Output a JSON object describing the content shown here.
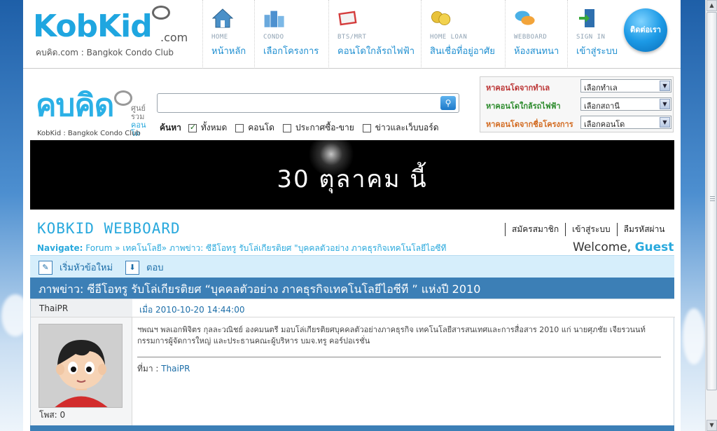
{
  "site": {
    "logo_text": "KobKid",
    "logo_tld": ".com",
    "logo_sub": "คบคิด.com : Bangkok Condo Club"
  },
  "nav": [
    {
      "en": "HOME",
      "th": "หน้าหลัก",
      "icon": "home-icon"
    },
    {
      "en": "CONDO",
      "th": "เลือกโครงการ",
      "icon": "buildings-icon"
    },
    {
      "en": "BTS/MRT",
      "th": "คอนโดใกล้รถไฟฟ้า",
      "icon": "book-icon"
    },
    {
      "en": "HOME LOAN",
      "th": "สินเชื่อที่อยู่อาศัย",
      "icon": "coins-icon"
    },
    {
      "en": "WEBBOARD",
      "th": "ห้องสนทนา",
      "icon": "chat-bubbles-icon"
    },
    {
      "en": "SIGN IN",
      "th": "เข้าสู่ระบบ",
      "icon": "door-icon"
    }
  ],
  "contact_label": "ติดต่อเรา",
  "logo2": {
    "word": "คบคิด",
    "side_top": "ศูนย์รวม",
    "side_bottom": "คอนโด",
    "sub": "KobKid : Bangkok Condo Club"
  },
  "search": {
    "placeholder": "",
    "label": "ค้นหา",
    "options": [
      {
        "label": "ทั้งหมด",
        "checked": true
      },
      {
        "label": "คอนโด",
        "checked": false
      },
      {
        "label": "ประกาศซื้อ-ขาย",
        "checked": false
      },
      {
        "label": "ข่าวและเว็บบอร์ด",
        "checked": false
      }
    ]
  },
  "finder": [
    {
      "label": "หาคอนโดจากทำเล",
      "value": "เลือกทำเล"
    },
    {
      "label": "หาคอนโดใกล้รถไฟฟ้า",
      "value": "เลือกสถานี"
    },
    {
      "label": "หาคอนโดจากชื่อโครงการ",
      "value": "เลือกคอนโด"
    }
  ],
  "banner_text": "30 ตุลาคม นี้",
  "webboard": {
    "title": "KOBKID WEBBOARD",
    "nav_label": "Navigate:",
    "nav_path": "Forum » เทคโนโลยี» ภาพข่าว: ซีอีโอทรู รับโล่เกียรติยศ \"บุคคลตัวอย่าง ภาคธุรกิจเทคโนโลยีไอซีที",
    "links": [
      "สมัครสมาชิก",
      "เข้าสู่ระบบ",
      "ลืมรหัสผ่าน"
    ],
    "welcome_text": "Welcome,",
    "welcome_user": "Guest",
    "new_topic": "เริ่มหัวข้อใหม่",
    "reply": "ตอบ"
  },
  "topic": {
    "title": "ภาพข่าว: ซีอีโอทรู รับโล่เกียรติยศ “บุคคลตัวอย่าง ภาคธุรกิจเทคโนโลยีไอซีที ” แห่งปี 2010"
  },
  "post": {
    "author": "ThaiPR",
    "posts_count": "โพส: 0",
    "date": "เมื่อ 2010-10-20 14:44:00",
    "body": "ฯพณฯ พลเอกพิจิตร กุลละวณิชย์ องคมนตรี มอบโล่เกียรติยศบุคคลตัวอย่างภาคธุรกิจ เทคโนโลยีสารสนเทศและการสื่อสาร 2010 แก่ นายศุภชัย เจียรวนนท์ กรรมการผู้จัดการใหญ่ และประธานคณะผู้บริหาร บมจ.ทรู คอร์ปอเรชั่น",
    "source_label": "ที่มา :",
    "source_value": "ThaiPR"
  }
}
